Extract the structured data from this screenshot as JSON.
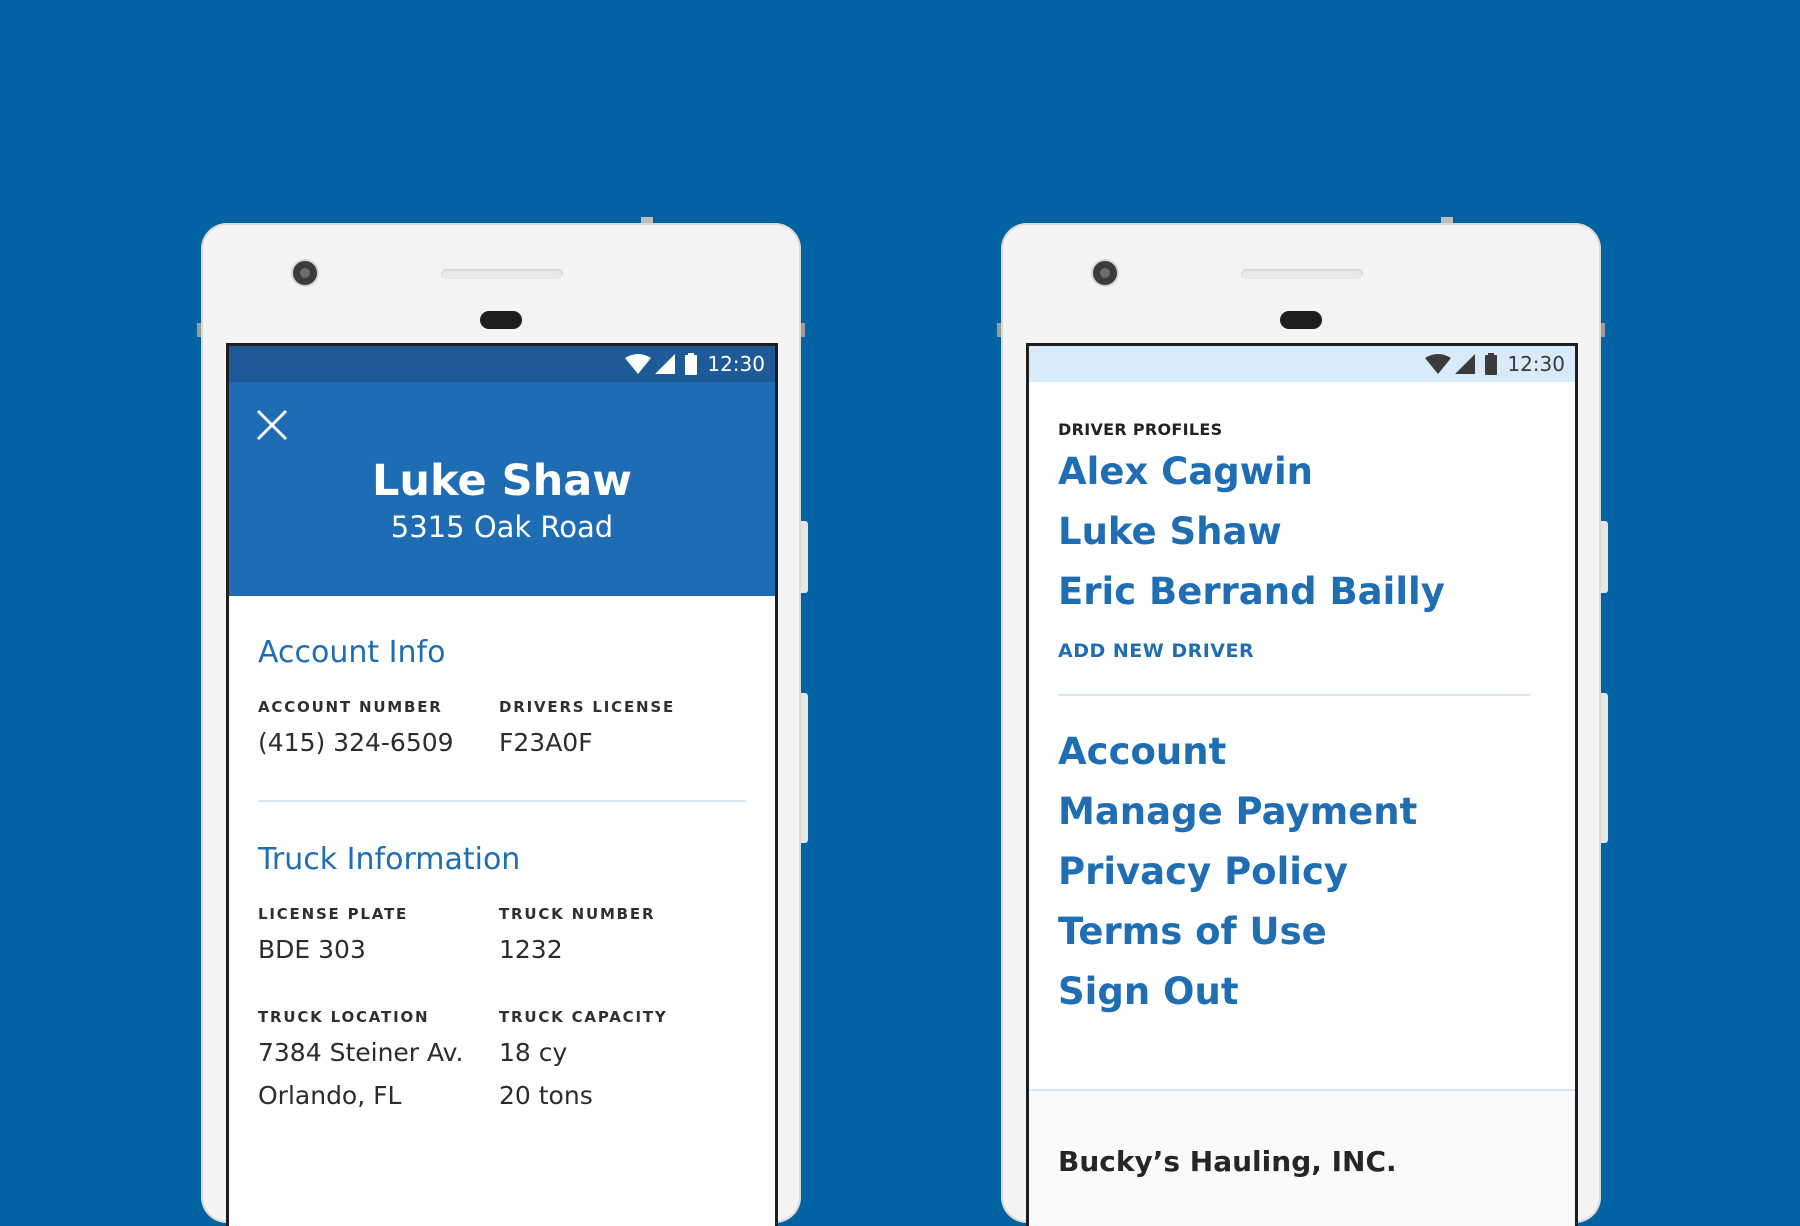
{
  "status": {
    "time": "12:30"
  },
  "profile": {
    "name": "Luke Shaw",
    "address": "5315 Oak Road",
    "account_section": {
      "title": "Account Info",
      "fields": [
        {
          "label": "ACCOUNT NUMBER",
          "value": "(415) 324-6509"
        },
        {
          "label": "DRIVERS LICENSE",
          "value": "F23A0F"
        }
      ]
    },
    "truck_section": {
      "title": "Truck Information",
      "fields": [
        {
          "label": "LICENSE PLATE",
          "value": "BDE 303"
        },
        {
          "label": "TRUCK NUMBER",
          "value": "1232"
        },
        {
          "label": "TRUCK LOCATION",
          "value": "7384 Steiner Av.",
          "value2": "Orlando, FL"
        },
        {
          "label": "TRUCK CAPACITY",
          "value": "18 cy",
          "value2": "20 tons"
        }
      ]
    }
  },
  "menu": {
    "section_label": "DRIVER PROFILES",
    "drivers": [
      "Alex Cagwin",
      "Luke Shaw",
      "Eric Berrand Bailly"
    ],
    "add_driver_label": "ADD NEW DRIVER",
    "items": [
      "Account",
      "Manage Payment",
      "Privacy Policy",
      "Terms of Use",
      "Sign Out"
    ],
    "company": "Bucky’s Hauling, INC."
  },
  "colors": {
    "background": "#0163a1",
    "accent": "#1f6db3",
    "header": "#1d6cb4",
    "statusbar_dark": "#1f5a98",
    "statusbar_light": "#d9ebfa"
  }
}
